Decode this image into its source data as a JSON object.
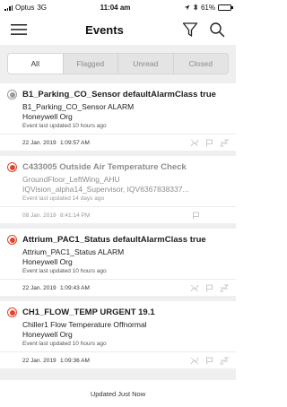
{
  "status_bar": {
    "carrier": "Optus",
    "network": "3G",
    "time": "11:04 am",
    "battery_percent": "61%",
    "battery_level": 0.61
  },
  "header": {
    "title": "Events",
    "menu_icon": "hamburger-menu-icon",
    "filter_icon": "filter-funnel-icon",
    "search_icon": "search-icon"
  },
  "tabs": [
    {
      "label": "All",
      "active": true
    },
    {
      "label": "Flagged",
      "active": false
    },
    {
      "label": "Unread",
      "active": false
    },
    {
      "label": "Closed",
      "active": false
    }
  ],
  "events": [
    {
      "title": "B1_Parking_CO_Sensor defaultAlarmClass true",
      "line1": "B1_Parking_CO_Sensor ALARM",
      "line2": "Honeywell Org",
      "updated": "Event last updated 10 hours ago",
      "date": "22 Jan. 2019",
      "time": "1:09:57 AM",
      "indicator_color": "#999999",
      "dim": false,
      "icons": [
        "acknowledge-icon",
        "flag-icon",
        "sleep-icon"
      ]
    },
    {
      "title": "C433005 Outside Air Temperature Check",
      "line1": "GroundFloor_LeftWing_AHU",
      "line2": "IQVision_alpha14_Supervisor, IQV6367838337...",
      "updated": "Event last updated 14 days ago",
      "date": "08 Jan. 2019",
      "time": "8:41:14 PM",
      "indicator_color": "#e4432b",
      "dim": true,
      "icons": [
        "flag-icon"
      ]
    },
    {
      "title": "Attrium_PAC1_Status defaultAlarmClass true",
      "line1": "Attrium_PAC1_Status ALARM",
      "line2": "Honeywell Org",
      "updated": "Event last updated 10 hours ago",
      "date": "22 Jan. 2019",
      "time": "1:09:43 AM",
      "indicator_color": "#e4432b",
      "dim": false,
      "icons": [
        "acknowledge-icon",
        "flag-icon",
        "sleep-icon"
      ]
    },
    {
      "title": "CH1_FLOW_TEMP URGENT 19.1",
      "line1": "Chiller1 Flow Temperature Offnormal",
      "line2": "Honeywell Org",
      "updated": "Event last updated 10 hours ago",
      "date": "22 Jan. 2019",
      "time": "1:09:36 AM",
      "indicator_color": "#e4432b",
      "dim": false,
      "icons": [
        "acknowledge-icon",
        "flag-icon",
        "sleep-icon"
      ]
    }
  ],
  "footer": {
    "status": "Updated Just Now"
  }
}
